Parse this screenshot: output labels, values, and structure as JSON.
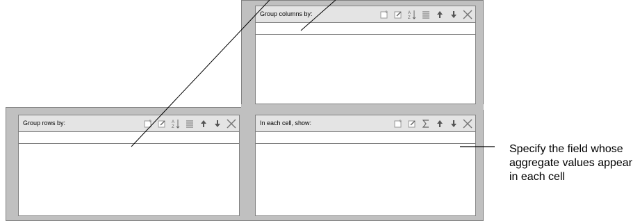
{
  "panes": {
    "group_columns": {
      "title": "Group columns by:",
      "icons": [
        "new-field-icon",
        "edit-field-icon",
        "sort-icon",
        "options-icon",
        "move-up-icon",
        "move-down-icon",
        "delete-icon"
      ]
    },
    "group_rows": {
      "title": "Group rows by:",
      "icons": [
        "new-field-icon",
        "edit-field-icon",
        "sort-icon",
        "options-icon",
        "move-up-icon",
        "move-down-icon",
        "delete-icon"
      ]
    },
    "cell": {
      "title": "In each cell, show:",
      "icons": [
        "new-field-icon",
        "edit-field-icon",
        "sigma-icon",
        "move-up-icon",
        "move-down-icon",
        "delete-icon"
      ]
    }
  },
  "callout": {
    "text": "Specify the field whose aggregate values appear in each cell"
  }
}
